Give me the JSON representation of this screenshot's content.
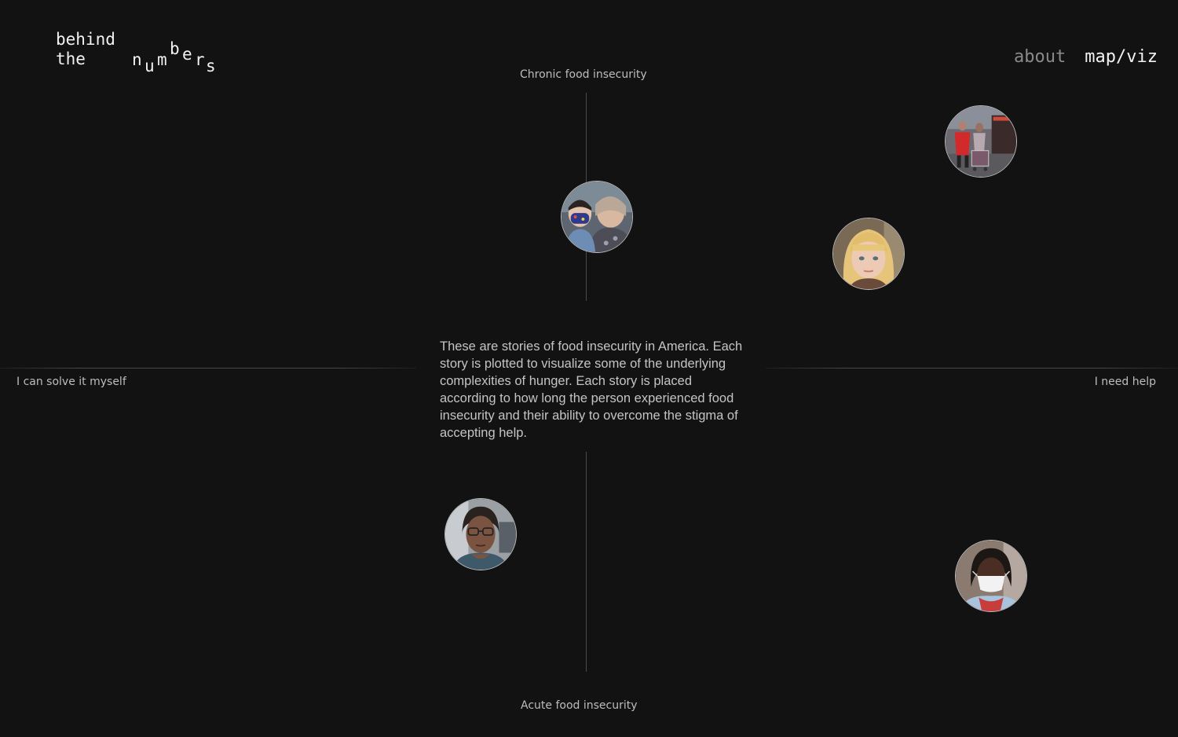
{
  "logo": {
    "line1": "behind",
    "line2": "the",
    "numbers_letters": [
      "n",
      "u",
      "m",
      "b",
      "e",
      "r",
      "s"
    ]
  },
  "nav": {
    "about": "about",
    "mapviz": "map/viz"
  },
  "axes": {
    "top": "Chronic food insecurity",
    "bottom": "Acute food insecurity",
    "left": "I can solve it myself",
    "right": "I need help"
  },
  "intro": "These are stories of food insecurity in America. Each story is plotted to visualize some of the underlying complexities of hunger. Each story is placed according to how long the person experienced food insecurity and their ability to overcome the stigma of accepting help.",
  "stories": [
    {
      "name": "story-boy-and-grandmother",
      "alt": "child in mask with woman"
    },
    {
      "name": "story-people-with-cart",
      "alt": "people with shopping cart on street"
    },
    {
      "name": "story-blonde-girl",
      "alt": "blonde girl portrait"
    },
    {
      "name": "story-woman-glasses",
      "alt": "woman with glasses portrait"
    },
    {
      "name": "story-woman-mask",
      "alt": "woman wearing mask"
    }
  ]
}
